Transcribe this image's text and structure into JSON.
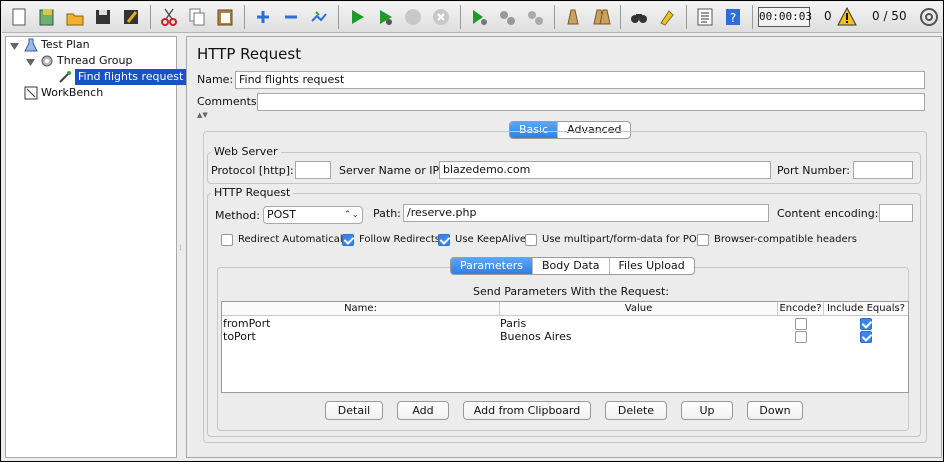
{
  "toolbar": {
    "buttons": [
      "new-icon",
      "templates-icon",
      "open-icon",
      "save-icon",
      "save-as-icon",
      "cut-icon",
      "copy-icon",
      "paste-icon",
      "expand-icon",
      "collapse-icon",
      "toggle-icon",
      "start-icon",
      "start-no-pause-icon",
      "stop-icon",
      "shutdown-icon",
      "remote-start-icon",
      "remote-stop-icon",
      "remote-shutdown-icon",
      "clear-icon",
      "clear-all-icon",
      "search-icon",
      "reset-search-icon",
      "function-helper-icon",
      "help-icon"
    ],
    "timer": "00:00:03",
    "error_count": "0",
    "threads": "0 / 50"
  },
  "tree": {
    "test_plan": "Test Plan",
    "thread_group": "Thread Group",
    "sampler": "Find flights request",
    "workbench": "WorkBench"
  },
  "panel": {
    "title": "HTTP Request",
    "name_label": "Name:",
    "name_value": "Find flights request",
    "comments_label": "Comments:",
    "comments_value": "",
    "tabs": [
      {
        "label": "Basic",
        "active": true
      },
      {
        "label": "Advanced",
        "active": false
      }
    ],
    "web_server": {
      "legend": "Web Server",
      "protocol_label": "Protocol [http]:",
      "protocol_value": "",
      "server_label": "Server Name or IP:",
      "server_value": "blazedemo.com",
      "port_label": "Port Number:",
      "port_value": ""
    },
    "http_request": {
      "legend": "HTTP Request",
      "method_label": "Method:",
      "method_value": "POST",
      "path_label": "Path:",
      "path_value": "/reserve.php",
      "encoding_label": "Content encoding:",
      "encoding_value": "",
      "options": [
        {
          "label": "Redirect Automatically",
          "checked": false
        },
        {
          "label": "Follow Redirects",
          "checked": true
        },
        {
          "label": "Use KeepAlive",
          "checked": true
        },
        {
          "label": "Use multipart/form-data for POST",
          "checked": false
        },
        {
          "label": "Browser-compatible headers",
          "checked": false
        }
      ]
    },
    "param_tabs": [
      {
        "label": "Parameters",
        "active": true
      },
      {
        "label": "Body Data",
        "active": false
      },
      {
        "label": "Files Upload",
        "active": false
      }
    ],
    "params_caption": "Send Parameters With the Request:",
    "columns": {
      "name": "Name:",
      "value": "Value",
      "encode": "Encode?",
      "include": "Include Equals?"
    },
    "rows": [
      {
        "name": "fromPort",
        "value": "Paris",
        "encode": false,
        "include": true
      },
      {
        "name": "toPort",
        "value": "Buenos Aires",
        "encode": false,
        "include": true
      }
    ],
    "buttons": {
      "detail": "Detail",
      "add": "Add",
      "add_clipboard": "Add from Clipboard",
      "delete": "Delete",
      "up": "Up",
      "down": "Down"
    }
  },
  "colors": {
    "accent": "#2f7fe6",
    "selection": "#1a52c6"
  }
}
